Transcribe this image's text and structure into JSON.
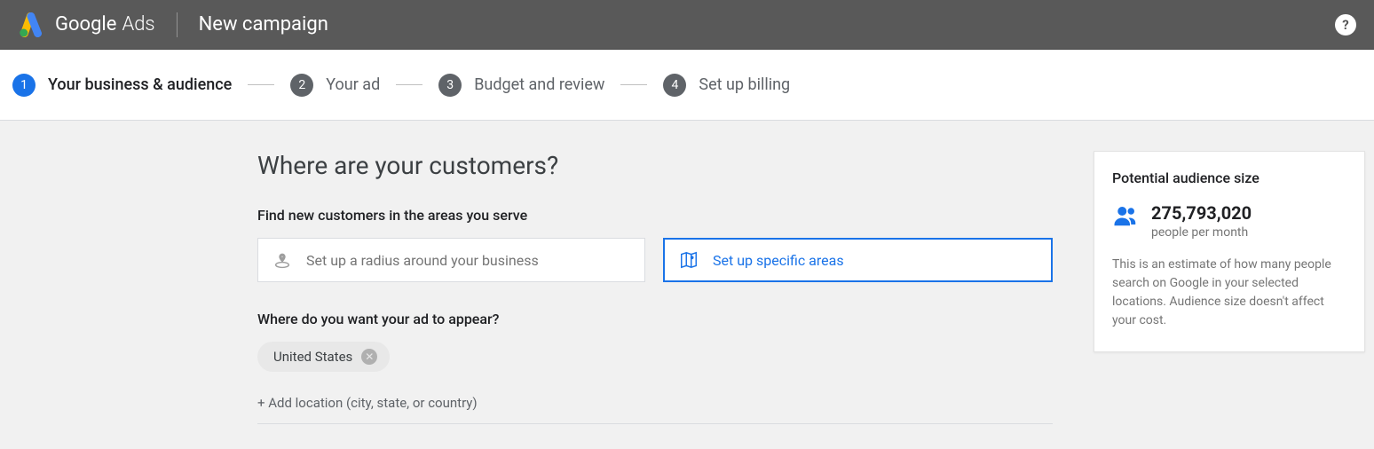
{
  "header": {
    "product_word1": "Google",
    "product_word2": "Ads",
    "title": "New campaign",
    "help_glyph": "?"
  },
  "stepper": {
    "items": [
      {
        "num": "1",
        "label": "Your business & audience",
        "active": true
      },
      {
        "num": "2",
        "label": "Your ad",
        "active": false
      },
      {
        "num": "3",
        "label": "Budget and review",
        "active": false
      },
      {
        "num": "4",
        "label": "Set up billing",
        "active": false
      }
    ]
  },
  "page": {
    "heading": "Where are your customers?",
    "find_heading": "Find new customers in the areas you serve",
    "option_radius": "Set up a radius around your business",
    "option_areas": "Set up specific areas",
    "appear_heading": "Where do you want your ad to appear?",
    "locations": [
      {
        "name": "United States"
      }
    ],
    "add_location_label": "+ Add location (city, state, or country)"
  },
  "panel": {
    "title": "Potential audience size",
    "count": "275,793,020",
    "count_sub": "people per month",
    "desc": "This is an estimate of how many people search on Google in your selected locations. Audience size doesn't affect your cost."
  }
}
